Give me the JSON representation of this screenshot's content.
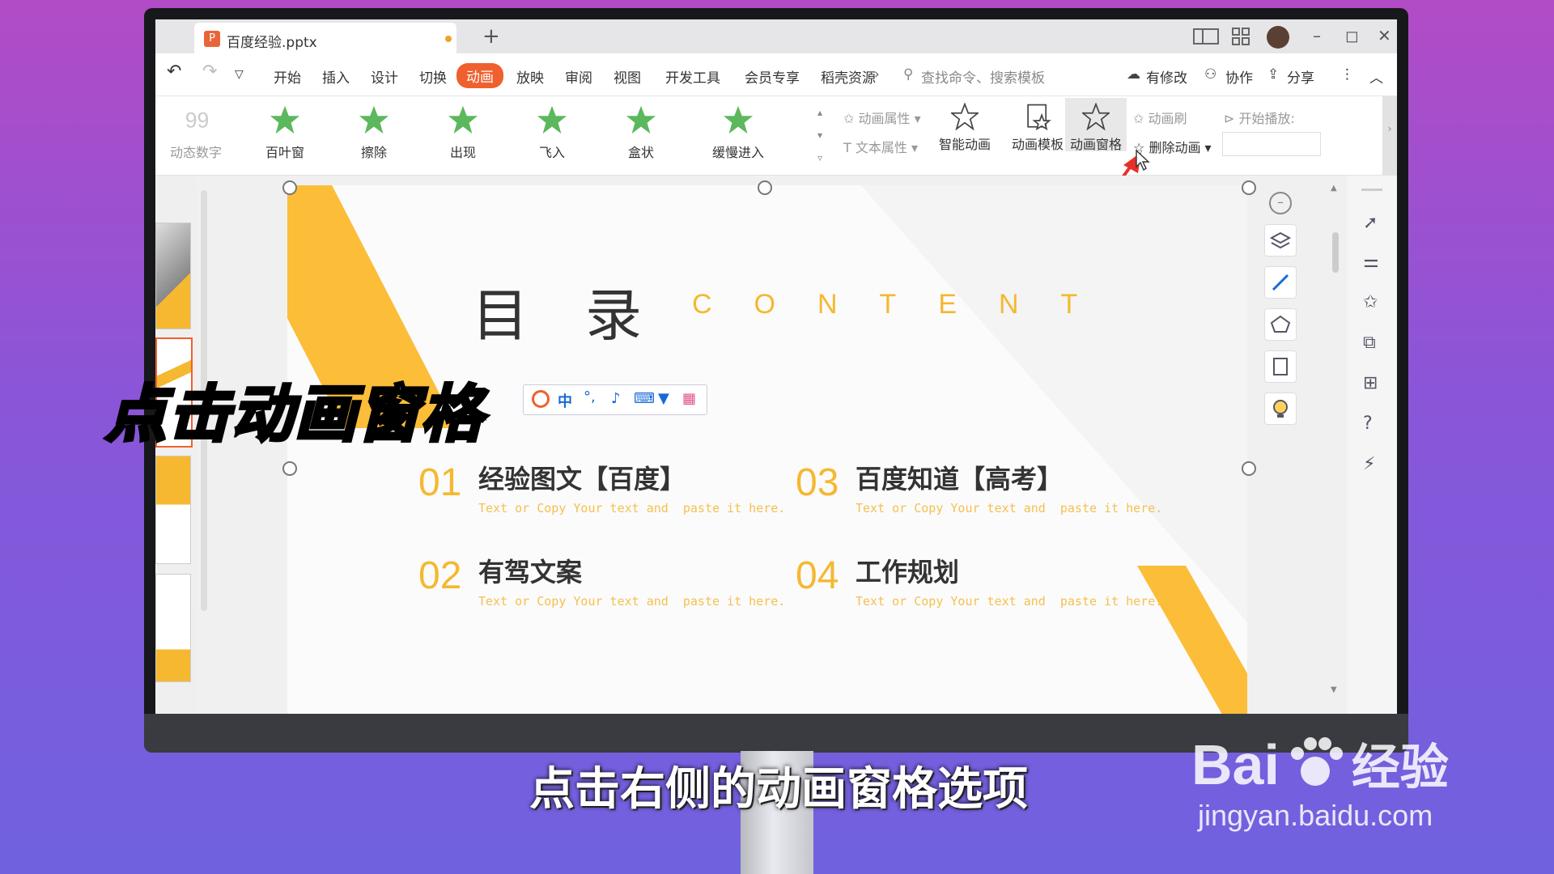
{
  "window": {
    "tab_title": "百度经验.pptx",
    "tab_logo": "P",
    "new_tab": "+",
    "controls": [
      "–",
      "◻",
      "✕"
    ]
  },
  "menubar": {
    "items": [
      "开始",
      "插入",
      "设计",
      "切换",
      "动画",
      "放映",
      "审阅",
      "视图",
      "开发工具",
      "会员专享",
      "稻壳资源"
    ],
    "active": "动画",
    "search_placeholder": "查找命令、搜索模板",
    "right": {
      "modified": "有修改",
      "collab": "协作",
      "share": "分享"
    }
  },
  "ribbon": {
    "animations": [
      "动态数字",
      "百叶窗",
      "擦除",
      "出现",
      "飞入",
      "盒状",
      "缓慢进入"
    ],
    "anim_props": "动画属性",
    "text_props": "文本属性",
    "smart_anim": "智能动画",
    "anim_template": "动画模板",
    "anim_pane": "动画窗格",
    "anim_brush": "动画刷",
    "delete_anim": "删除动画",
    "start_play": "开始播放:"
  },
  "slide": {
    "title_cn": "目录",
    "title_en": "CONTENT",
    "items": [
      {
        "num": "01",
        "title": "经验图文【百度】",
        "sub": "Text or Copy Your text and  paste it here."
      },
      {
        "num": "02",
        "title": "有驾文案",
        "sub": "Text or Copy Your text and  paste it here."
      },
      {
        "num": "03",
        "title": "百度知道【高考】",
        "sub": "Text or Copy Your text and  paste it here."
      },
      {
        "num": "04",
        "title": "工作规划",
        "sub": "Text or Copy Your text and  paste it here."
      }
    ]
  },
  "ime_toolbar": {
    "lang": "中"
  },
  "captions": {
    "big": "点击动画窗格",
    "subtitle": "点击右侧的动画窗格选项"
  },
  "watermark": {
    "brand": "Bai",
    "brand2": "经验",
    "url": "jingyan.baidu.com"
  },
  "colors": {
    "accent": "#f0602e",
    "slide_yellow": "#f5b830",
    "star_green": "#5cb85c"
  }
}
